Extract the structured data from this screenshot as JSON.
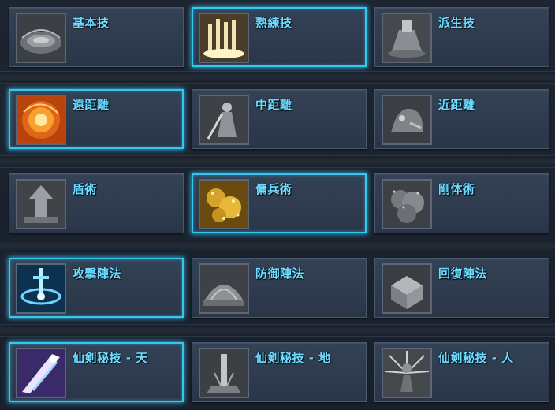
{
  "colors": {
    "accent": "#35c7f2",
    "label": "#6fdcff",
    "panel": "#2f3c4f"
  },
  "rows": [
    {
      "items": [
        {
          "label": "基本技",
          "icon": "arena-icon",
          "selected": false
        },
        {
          "label": "熟練技",
          "icon": "light-pillars-icon",
          "selected": true
        },
        {
          "label": "派生技",
          "icon": "monument-icon",
          "selected": false
        }
      ]
    },
    {
      "items": [
        {
          "label": "遠距離",
          "icon": "fire-orb-icon",
          "selected": true
        },
        {
          "label": "中距離",
          "icon": "warrior-icon",
          "selected": false
        },
        {
          "label": "近距離",
          "icon": "beast-icon",
          "selected": false
        }
      ]
    },
    {
      "items": [
        {
          "label": "盾術",
          "icon": "shield-tower-icon",
          "selected": false
        },
        {
          "label": "傭兵術",
          "icon": "gold-sparkle-icon",
          "selected": true
        },
        {
          "label": "剛体術",
          "icon": "dust-cloud-icon",
          "selected": false
        }
      ]
    },
    {
      "items": [
        {
          "label": "攻撃陣法",
          "icon": "chained-sword-icon",
          "selected": true
        },
        {
          "label": "防御陣法",
          "icon": "dome-icon",
          "selected": false
        },
        {
          "label": "回復陣法",
          "icon": "chest-icon",
          "selected": false
        }
      ]
    },
    {
      "items": [
        {
          "label": "仙剣秘技 - 天",
          "icon": "sky-slash-icon",
          "selected": true
        },
        {
          "label": "仙剣秘技 - 地",
          "icon": "ground-blade-icon",
          "selected": false
        },
        {
          "label": "仙剣秘技 - 人",
          "icon": "radiant-figure-icon",
          "selected": false
        }
      ]
    }
  ]
}
